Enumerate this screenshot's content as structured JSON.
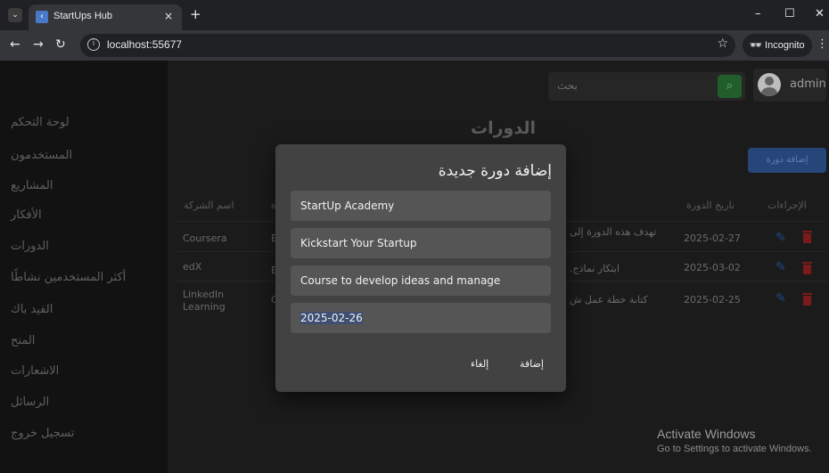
{
  "browser": {
    "tab_title": "StartUps Hub",
    "tab_close": "×",
    "new_tab": "+",
    "url": "localhost:55677",
    "incognito_label": "Incognito",
    "window_controls": [
      "–",
      "☐",
      "✕"
    ]
  },
  "sidebar": {
    "items": [
      {
        "label": "لوحة التحكم"
      },
      {
        "label": "المستخدمون"
      },
      {
        "label": "المشاريع"
      },
      {
        "label": "الأفكار"
      },
      {
        "label": "الدورات"
      },
      {
        "label": "أكثر المستخدمين نشاطًا"
      },
      {
        "label": "الفيد باك"
      },
      {
        "label": "المنح"
      },
      {
        "label": "الاشعارات"
      },
      {
        "label": "الرسائل"
      },
      {
        "label": "تسجيل خروج"
      }
    ]
  },
  "header": {
    "search_placeholder": "بحث",
    "user_name": "admin"
  },
  "page": {
    "title": "الدورات",
    "add_button": "إضافة دورة"
  },
  "table": {
    "headers": {
      "company": "اسم الشركة",
      "partial": "ة",
      "date": "تاريخ الدورة",
      "actions": "الإجراءات"
    },
    "rows": [
      {
        "company": "Coursera",
        "partial": "E",
        "description": "تهدف هذه الدورة إلى",
        "date": "2025-02-27"
      },
      {
        "company": "edX",
        "partial": "E",
        "description": ".ابتكار نماذج",
        "date": "2025-03-02"
      },
      {
        "company": "LinkedIn Learning",
        "partial": "C",
        "description": "كتابة خطة عمل ش",
        "date": "2025-02-25"
      }
    ]
  },
  "dialog": {
    "title": "إضافة دورة جديدة",
    "fields": {
      "company": "StartUp Academy",
      "name": "Kickstart Your Startup",
      "description": "Course to develop ideas and manage startups.",
      "date": "2025-02-26"
    },
    "cancel_label": "إلغاء",
    "submit_label": "إضافة"
  },
  "watermark": {
    "line1": "Activate Windows",
    "line2": "Go to Settings to activate Windows."
  },
  "colors": {
    "accent_blue": "#26467a",
    "search_green": "#215e2b",
    "delete_red": "#7a1a1a",
    "dialog_bg": "#424242"
  }
}
